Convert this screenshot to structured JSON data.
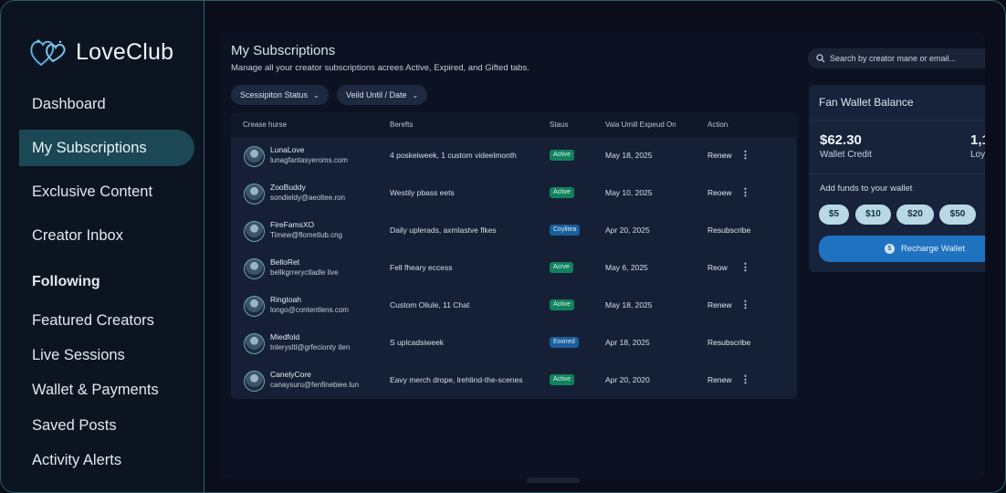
{
  "brand": {
    "name": "LoveClub"
  },
  "sidebar": {
    "items": [
      {
        "label": "Dashboard"
      },
      {
        "label": "My Subscriptions"
      },
      {
        "label": "Exclusive Content"
      },
      {
        "label": "Creator Inbox"
      }
    ],
    "section_heading": "Following",
    "following_items": [
      {
        "label": "Featured Creators"
      },
      {
        "label": "Live Sessions"
      },
      {
        "label": "Wallet & Payments"
      },
      {
        "label": "Saved Posts"
      },
      {
        "label": "Activity Alerts"
      }
    ]
  },
  "page": {
    "title": "My Subscriptions",
    "subtitle": "Manage all your creator subscriptions acrees Active, Expired, and Gifted tabs."
  },
  "filters": [
    {
      "label": "Scessipiton Status"
    },
    {
      "label": "Veild Until / Date"
    }
  ],
  "search": {
    "placeholder": "Search by creator mane or email..."
  },
  "table": {
    "headers": [
      "Crease hurse",
      "Berefts",
      "Staus",
      "Vala Umill Expeud On",
      "Action"
    ],
    "rows": [
      {
        "name": "LunaLove",
        "email": "lunagfantasyeroms.com",
        "benefits": "4 poskeiweek, 1 custom videelmonth",
        "status": "Active",
        "date": "May 18, 2025",
        "action": "Renew"
      },
      {
        "name": "ZooBuddy",
        "email": "sondieldy@aeoltee.ron",
        "benefits": "Westily pbass eets",
        "status": "Active",
        "date": "May 10, 2025",
        "action": "Reoew"
      },
      {
        "name": "FireFamsXO",
        "email": "Timew@flometlub.cng",
        "benefits": "Daily uplerads, axmlastve flkes",
        "status": "Coylitea",
        "date": "Apr 20, 2025",
        "action": "Resubscribe"
      },
      {
        "name": "BelloRet",
        "email": "bellkgrreryctladle live",
        "benefits": "Fell fheary eccess",
        "status": "Acrve",
        "date": "May 6, 2025",
        "action": "Reow"
      },
      {
        "name": "Ringtoah",
        "email": "longo@contentlens.com",
        "benefits": "Custom Oliule, 11 Chat",
        "status": "Active",
        "date": "May 18, 2025",
        "action": "Renew"
      },
      {
        "name": "Miedfold",
        "email": "tnlerysltl@grfecionty tlen",
        "benefits": "S uplcadsiweek",
        "status": "Eoxired",
        "date": "Apr 18, 2025",
        "action": "Resubscribe"
      },
      {
        "name": "CanelyCore",
        "email": "canaysuru@fenfinebiee.lun",
        "benefits": "Eavy merch drope, lrehlind-the-scenes",
        "status": "Active",
        "date": "Apr 20, 2020",
        "action": "Renew"
      }
    ]
  },
  "wallet": {
    "title": "Fan Wallet Balance",
    "amount": "$62.30",
    "amount_label": "Wallet Credit",
    "loyalty_amount": "1,1",
    "loyalty_label": "Loy",
    "add_funds_label": "Add funds to your wallet",
    "fund_options": [
      "$5",
      "$10",
      "$20",
      "$50"
    ],
    "recharge_label": "Recharge Wallet"
  },
  "colors": {
    "accent": "#1f72c0",
    "active_nav": "#1c4855",
    "status_active": "#12825e",
    "status_expired": "#1b5e9a"
  }
}
